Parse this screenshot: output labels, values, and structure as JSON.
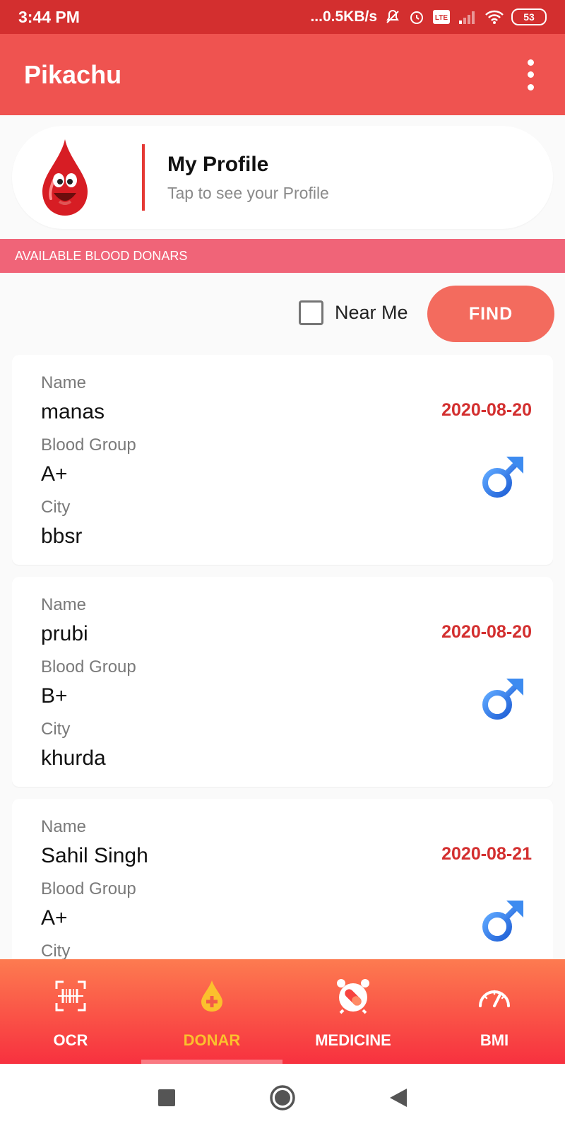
{
  "status_bar": {
    "time": "3:44 PM",
    "network_speed": "...0.5KB/s",
    "battery": "53"
  },
  "app_bar": {
    "title": "Pikachu"
  },
  "profile": {
    "title": "My Profile",
    "subtitle": "Tap to see your Profile"
  },
  "section": {
    "header": "AVAILABLE BLOOD DONARS"
  },
  "filter": {
    "near_me_label": "Near Me",
    "near_me_checked": false,
    "find_label": "FIND"
  },
  "donors": [
    {
      "name_label": "Name",
      "name": "manas",
      "blood_group_label": "Blood Group",
      "blood_group": "A+",
      "city_label": "City",
      "city": "bbsr",
      "date": "2020-08-20",
      "gender_icon": "male-icon"
    },
    {
      "name_label": "Name",
      "name": "prubi",
      "blood_group_label": "Blood Group",
      "blood_group": "B+",
      "city_label": "City",
      "city": "khurda",
      "date": "2020-08-20",
      "gender_icon": "male-icon"
    },
    {
      "name_label": "Name",
      "name": "Sahil Singh",
      "blood_group_label": "Blood Group",
      "blood_group": "A+",
      "city_label": "City",
      "city": "",
      "date": "2020-08-21",
      "gender_icon": "male-icon"
    }
  ],
  "bottom_nav": {
    "items": [
      {
        "label": "OCR",
        "icon": "barcode-scan-icon"
      },
      {
        "label": "DONAR",
        "icon": "blood-drop-plus-icon",
        "active": true
      },
      {
        "label": "MEDICINE",
        "icon": "alarm-pill-icon"
      },
      {
        "label": "BMI",
        "icon": "speedometer-icon"
      }
    ]
  },
  "colors": {
    "status_bar": "#d32f2f",
    "app_bar": "#ef5350",
    "section_header": "#f06478",
    "find_button": "#f36b5e",
    "date_text": "#d32f2f",
    "nav_active": "#fbc02d",
    "male_icon": "#2f7fe8"
  }
}
